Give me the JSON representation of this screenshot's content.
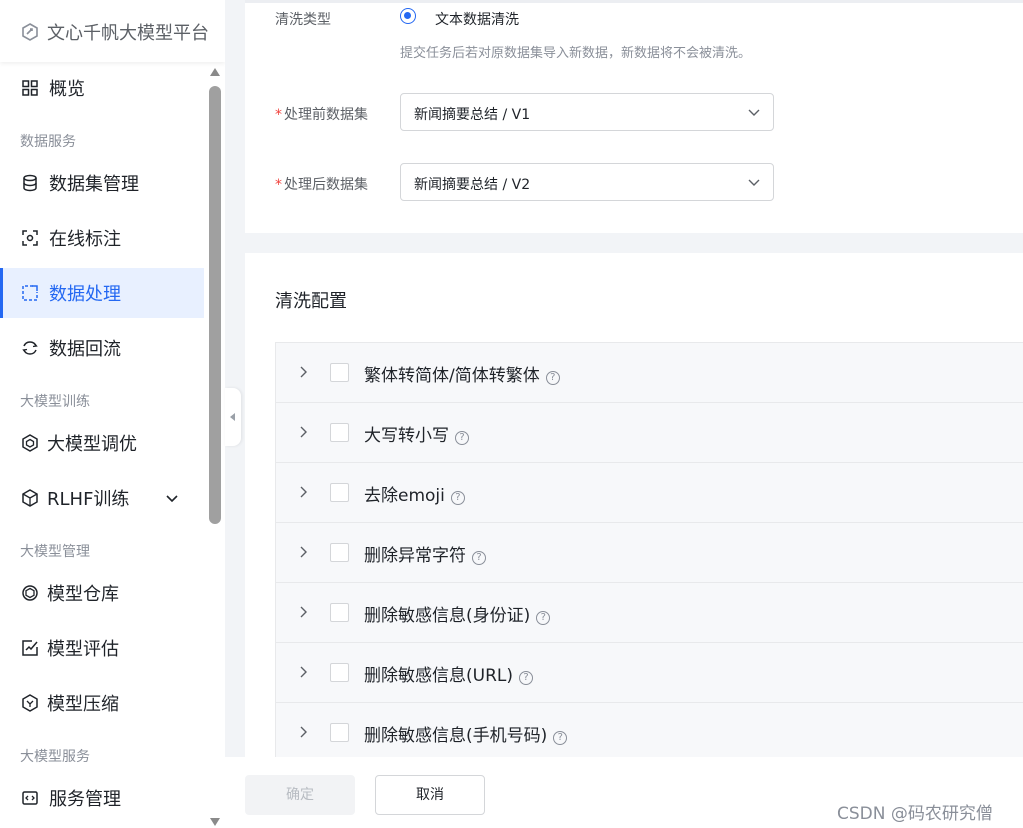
{
  "brand": {
    "title": "文心千帆大模型平台"
  },
  "sidebar": {
    "items": [
      {
        "label": "概览",
        "icon": "grid-icon"
      },
      {
        "group": "数据服务"
      },
      {
        "label": "数据集管理",
        "icon": "database-icon"
      },
      {
        "label": "在线标注",
        "icon": "annotate-icon"
      },
      {
        "label": "数据处理",
        "icon": "data-process-icon",
        "active": true
      },
      {
        "label": "数据回流",
        "icon": "reflow-icon"
      },
      {
        "group": "大模型训练"
      },
      {
        "label": "大模型调优",
        "icon": "tune-icon"
      },
      {
        "label": "RLHF训练",
        "icon": "cube-icon",
        "has_submenu": true
      },
      {
        "group": "大模型管理"
      },
      {
        "label": "模型仓库",
        "icon": "model-repo-icon"
      },
      {
        "label": "模型评估",
        "icon": "evaluate-icon"
      },
      {
        "label": "模型压缩",
        "icon": "compress-icon"
      },
      {
        "group": "大模型服务"
      },
      {
        "label": "服务管理",
        "icon": "service-icon"
      }
    ],
    "groups": {
      "data": "数据服务",
      "train": "大模型训练",
      "manage": "大模型管理",
      "serve": "大模型服务"
    },
    "labels": {
      "overview": "概览",
      "dataset": "数据集管理",
      "annotate": "在线标注",
      "process": "数据处理",
      "reflow": "数据回流",
      "tune": "大模型调优",
      "rlhf": "RLHF训练",
      "repo": "模型仓库",
      "evaluate": "模型评估",
      "compress": "模型压缩",
      "service": "服务管理"
    }
  },
  "form": {
    "clean_type_label": "清洗类型",
    "clean_type_option": "文本数据清洗",
    "clean_type_hint": "提交任务后若对原数据集导入新数据，新数据将不会被清洗。",
    "before_label": "处理前数据集",
    "before_value": "新闻摘要总结 / V1",
    "after_label": "处理后数据集",
    "after_value": "新闻摘要总结 / V2",
    "required_mark": "*"
  },
  "config": {
    "title": "清洗配置",
    "rules": [
      "繁体转简体/简体转繁体",
      "大写转小写",
      "去除emoji",
      "删除异常字符",
      "删除敏感信息(身份证)",
      "删除敏感信息(URL)",
      "删除敏感信息(手机号码)"
    ],
    "help_glyph": "?"
  },
  "footer": {
    "confirm_label": "确定",
    "cancel_label": "取消",
    "watermark": "CSDN @码农研究僧"
  },
  "colors": {
    "accent": "#2468f2",
    "required": "#f0413c",
    "active_bg": "#e8f0ff"
  }
}
